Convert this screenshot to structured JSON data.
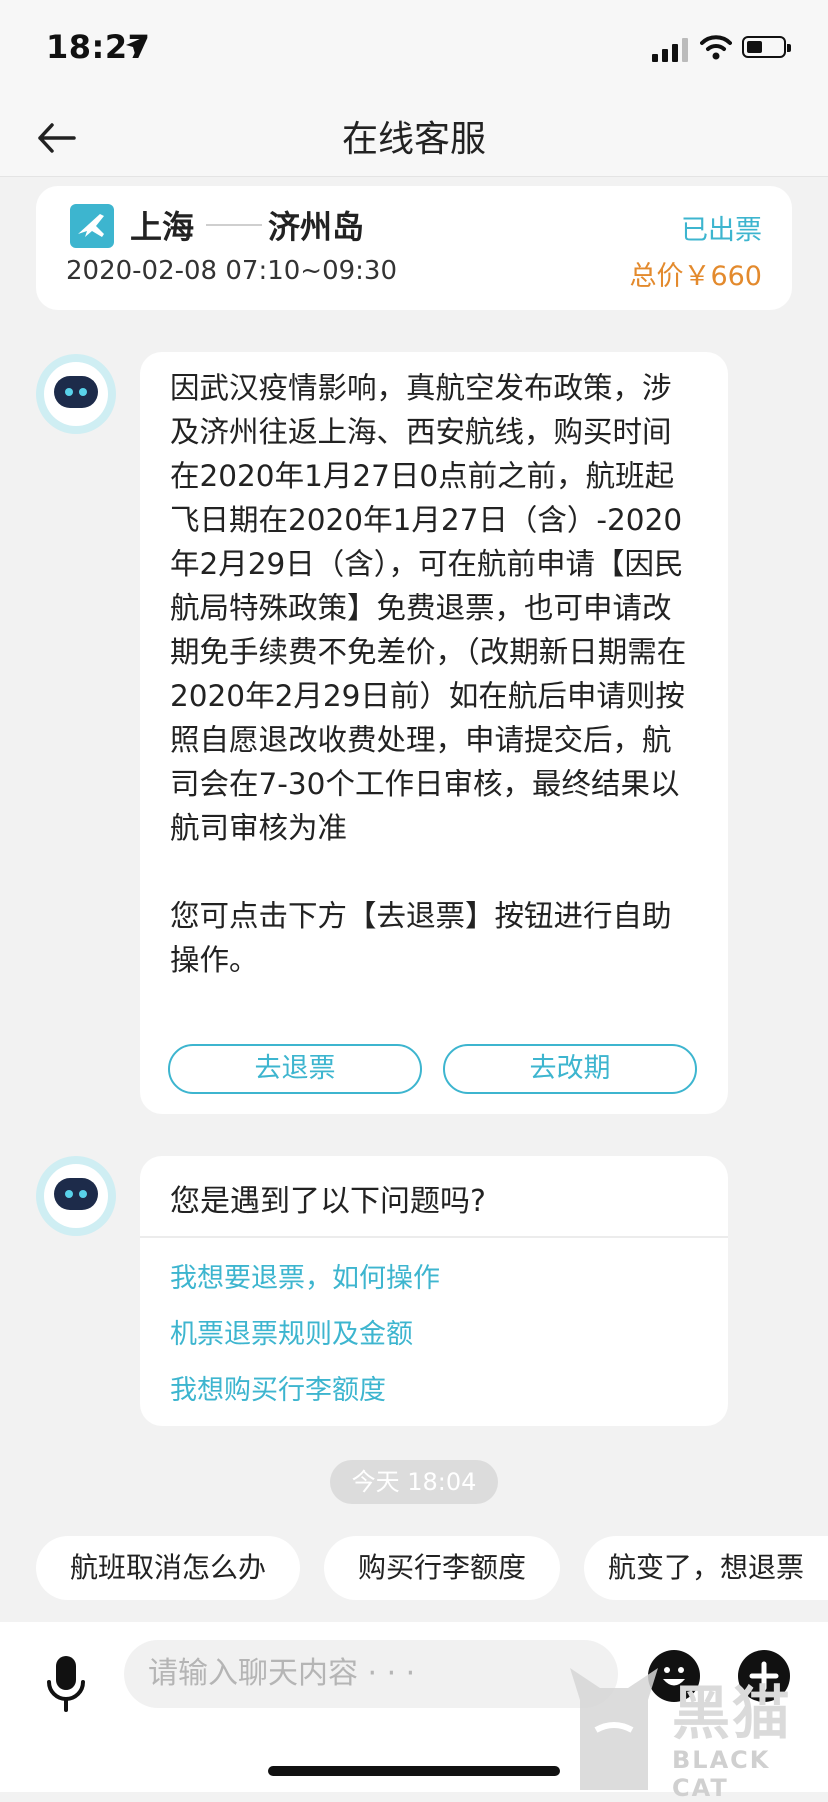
{
  "status_bar": {
    "time": "18:27"
  },
  "nav": {
    "title": "在线客服"
  },
  "flight": {
    "from": "上海",
    "to": "济州岛",
    "datetime": "2020-02-08 07:10~09:30",
    "status": "已出票",
    "price": "总价￥660"
  },
  "message1": {
    "paragraph1": "因武汉疫情影响，真航空发布政策，涉及济州往返上海、西安航线，购买时间在2020年1月27日0点前之前，航班起飞日期在2020年1月27日（含）-2020年2月29日（含），可在航前申请【因民航局特殊政策】免费退票，也可申请改期免手续费不免差价，（改期新日期需在2020年2月29日前）如在航后申请则按照自愿退改收费处理，申请提交后，航司会在7-30个工作日审核，最终结果以航司审核为准",
    "paragraph2": "您可点击下方【去退票】按钮进行自助操作。",
    "refund_button": "去退票",
    "change_button": "去改期"
  },
  "message2": {
    "title": "您是遇到了以下问题吗?",
    "items": [
      "我想要退票，如何操作",
      "机票退票规则及金额",
      "我想购买行李额度"
    ]
  },
  "timestamp": "今天 18:04",
  "quick_replies": [
    "航班取消怎么办",
    "购买行李额度",
    "航变了，想退票"
  ],
  "input": {
    "placeholder": "请输入聊天内容 · · ·"
  },
  "watermark": {
    "cn": "黑猫",
    "en": "BLACK CAT"
  },
  "colors": {
    "accent": "#3db5cf",
    "price": "#e38a2d"
  }
}
